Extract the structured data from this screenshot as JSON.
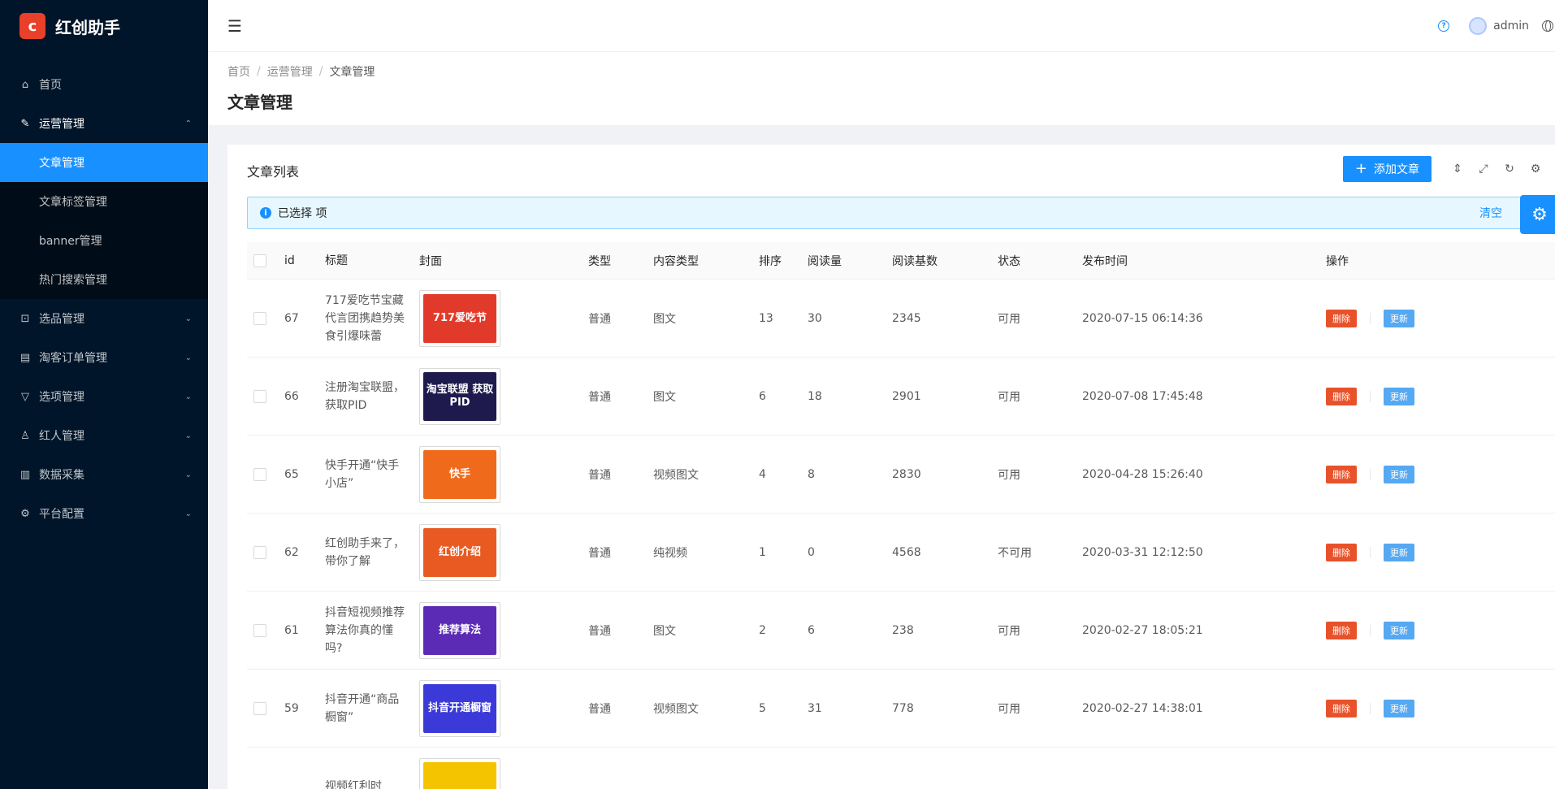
{
  "app": {
    "title": "红创助手",
    "logo_glyph": "c"
  },
  "sidebar": {
    "items": [
      {
        "label": "首页",
        "icon": "home-icon"
      },
      {
        "label": "运营管理",
        "icon": "edit-icon",
        "open": true,
        "children": [
          {
            "label": "文章管理",
            "active": true
          },
          {
            "label": "文章标签管理"
          },
          {
            "label": "banner管理"
          },
          {
            "label": "热门搜索管理"
          }
        ]
      },
      {
        "label": "选品管理",
        "icon": "shopping-icon"
      },
      {
        "label": "淘客订单管理",
        "icon": "file-icon"
      },
      {
        "label": "选项管理",
        "icon": "filter-icon"
      },
      {
        "label": "红人管理",
        "icon": "user-icon"
      },
      {
        "label": "数据采集",
        "icon": "database-icon"
      },
      {
        "label": "平台配置",
        "icon": "setting-icon"
      }
    ]
  },
  "header": {
    "user_name": "admin"
  },
  "breadcrumb": {
    "items": [
      "首页",
      "运营管理",
      "文章管理"
    ]
  },
  "page": {
    "title": "文章管理"
  },
  "card": {
    "title": "文章列表",
    "add_label": "添加文章",
    "alert_text": "已选择  项",
    "clear_label": "清空"
  },
  "table": {
    "columns": [
      "id",
      "标题",
      "封面",
      "类型",
      "内容类型",
      "排序",
      "阅读量",
      "阅读基数",
      "状态",
      "发布时间",
      "操作"
    ],
    "rows": [
      {
        "id": "67",
        "title": "717爱吃节宝藏代言团携趋势美食引爆味蕾",
        "cover_text": "717爱吃节",
        "cover_color": "#e23a2a",
        "type": "普通",
        "ctype": "图文",
        "sort": "13",
        "read": "30",
        "base": "2345",
        "status": "可用",
        "time": "2020-07-15 06:14:36",
        "del": "删除",
        "upd": "更新"
      },
      {
        "id": "66",
        "title": "注册淘宝联盟，获取PID",
        "cover_text": "淘宝联盟 获取PID",
        "cover_color": "#1f1a4d",
        "type": "普通",
        "ctype": "图文",
        "sort": "6",
        "read": "18",
        "base": "2901",
        "status": "可用",
        "time": "2020-07-08 17:45:48",
        "del": "删除",
        "upd": "更新"
      },
      {
        "id": "65",
        "title": "快手开通“快手小店”",
        "cover_text": "快手",
        "cover_color": "#f06a1b",
        "type": "普通",
        "ctype": "视频图文",
        "sort": "4",
        "read": "8",
        "base": "2830",
        "status": "可用",
        "time": "2020-04-28 15:26:40",
        "del": "删除",
        "upd": "更新"
      },
      {
        "id": "62",
        "title": "红创助手来了，带你了解",
        "cover_text": "红创介绍",
        "cover_color": "#e85a22",
        "type": "普通",
        "ctype": "纯视频",
        "sort": "1",
        "read": "0",
        "base": "4568",
        "status": "不可用",
        "time": "2020-03-31 12:12:50",
        "del": "删除",
        "upd": "更新"
      },
      {
        "id": "61",
        "title": "抖音短视频推荐算法你真的懂吗?",
        "cover_text": "推荐算法",
        "cover_color": "#5b2bb5",
        "type": "普通",
        "ctype": "图文",
        "sort": "2",
        "read": "6",
        "base": "238",
        "status": "可用",
        "time": "2020-02-27 18:05:21",
        "del": "删除",
        "upd": "更新"
      },
      {
        "id": "59",
        "title": "抖音开通“商品橱窗”",
        "cover_text": "抖音开通橱窗",
        "cover_color": "#3b3ad8",
        "type": "普通",
        "ctype": "视频图文",
        "sort": "5",
        "read": "31",
        "base": "778",
        "status": "可用",
        "time": "2020-02-27 14:38:01",
        "del": "删除",
        "upd": "更新"
      },
      {
        "id": "",
        "title": "视频红利时",
        "cover_text": "",
        "cover_color": "#f5c400",
        "type": "",
        "ctype": "",
        "sort": "",
        "read": "",
        "base": "",
        "status": "",
        "time": "",
        "del": "",
        "upd": ""
      }
    ]
  }
}
